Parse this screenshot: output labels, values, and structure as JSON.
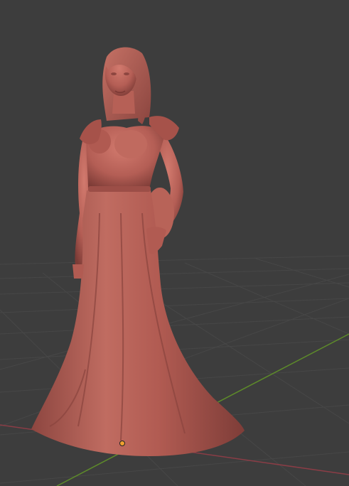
{
  "viewport": {
    "background_color": "#3d3d3d",
    "grid_color": "#474747",
    "x_axis_color": "#8a3d46",
    "y_axis_color": "#5d8a2a",
    "model_color": "#b45e55",
    "origin_color": "#f0a030",
    "origin_icon": "object-origin-icon"
  }
}
